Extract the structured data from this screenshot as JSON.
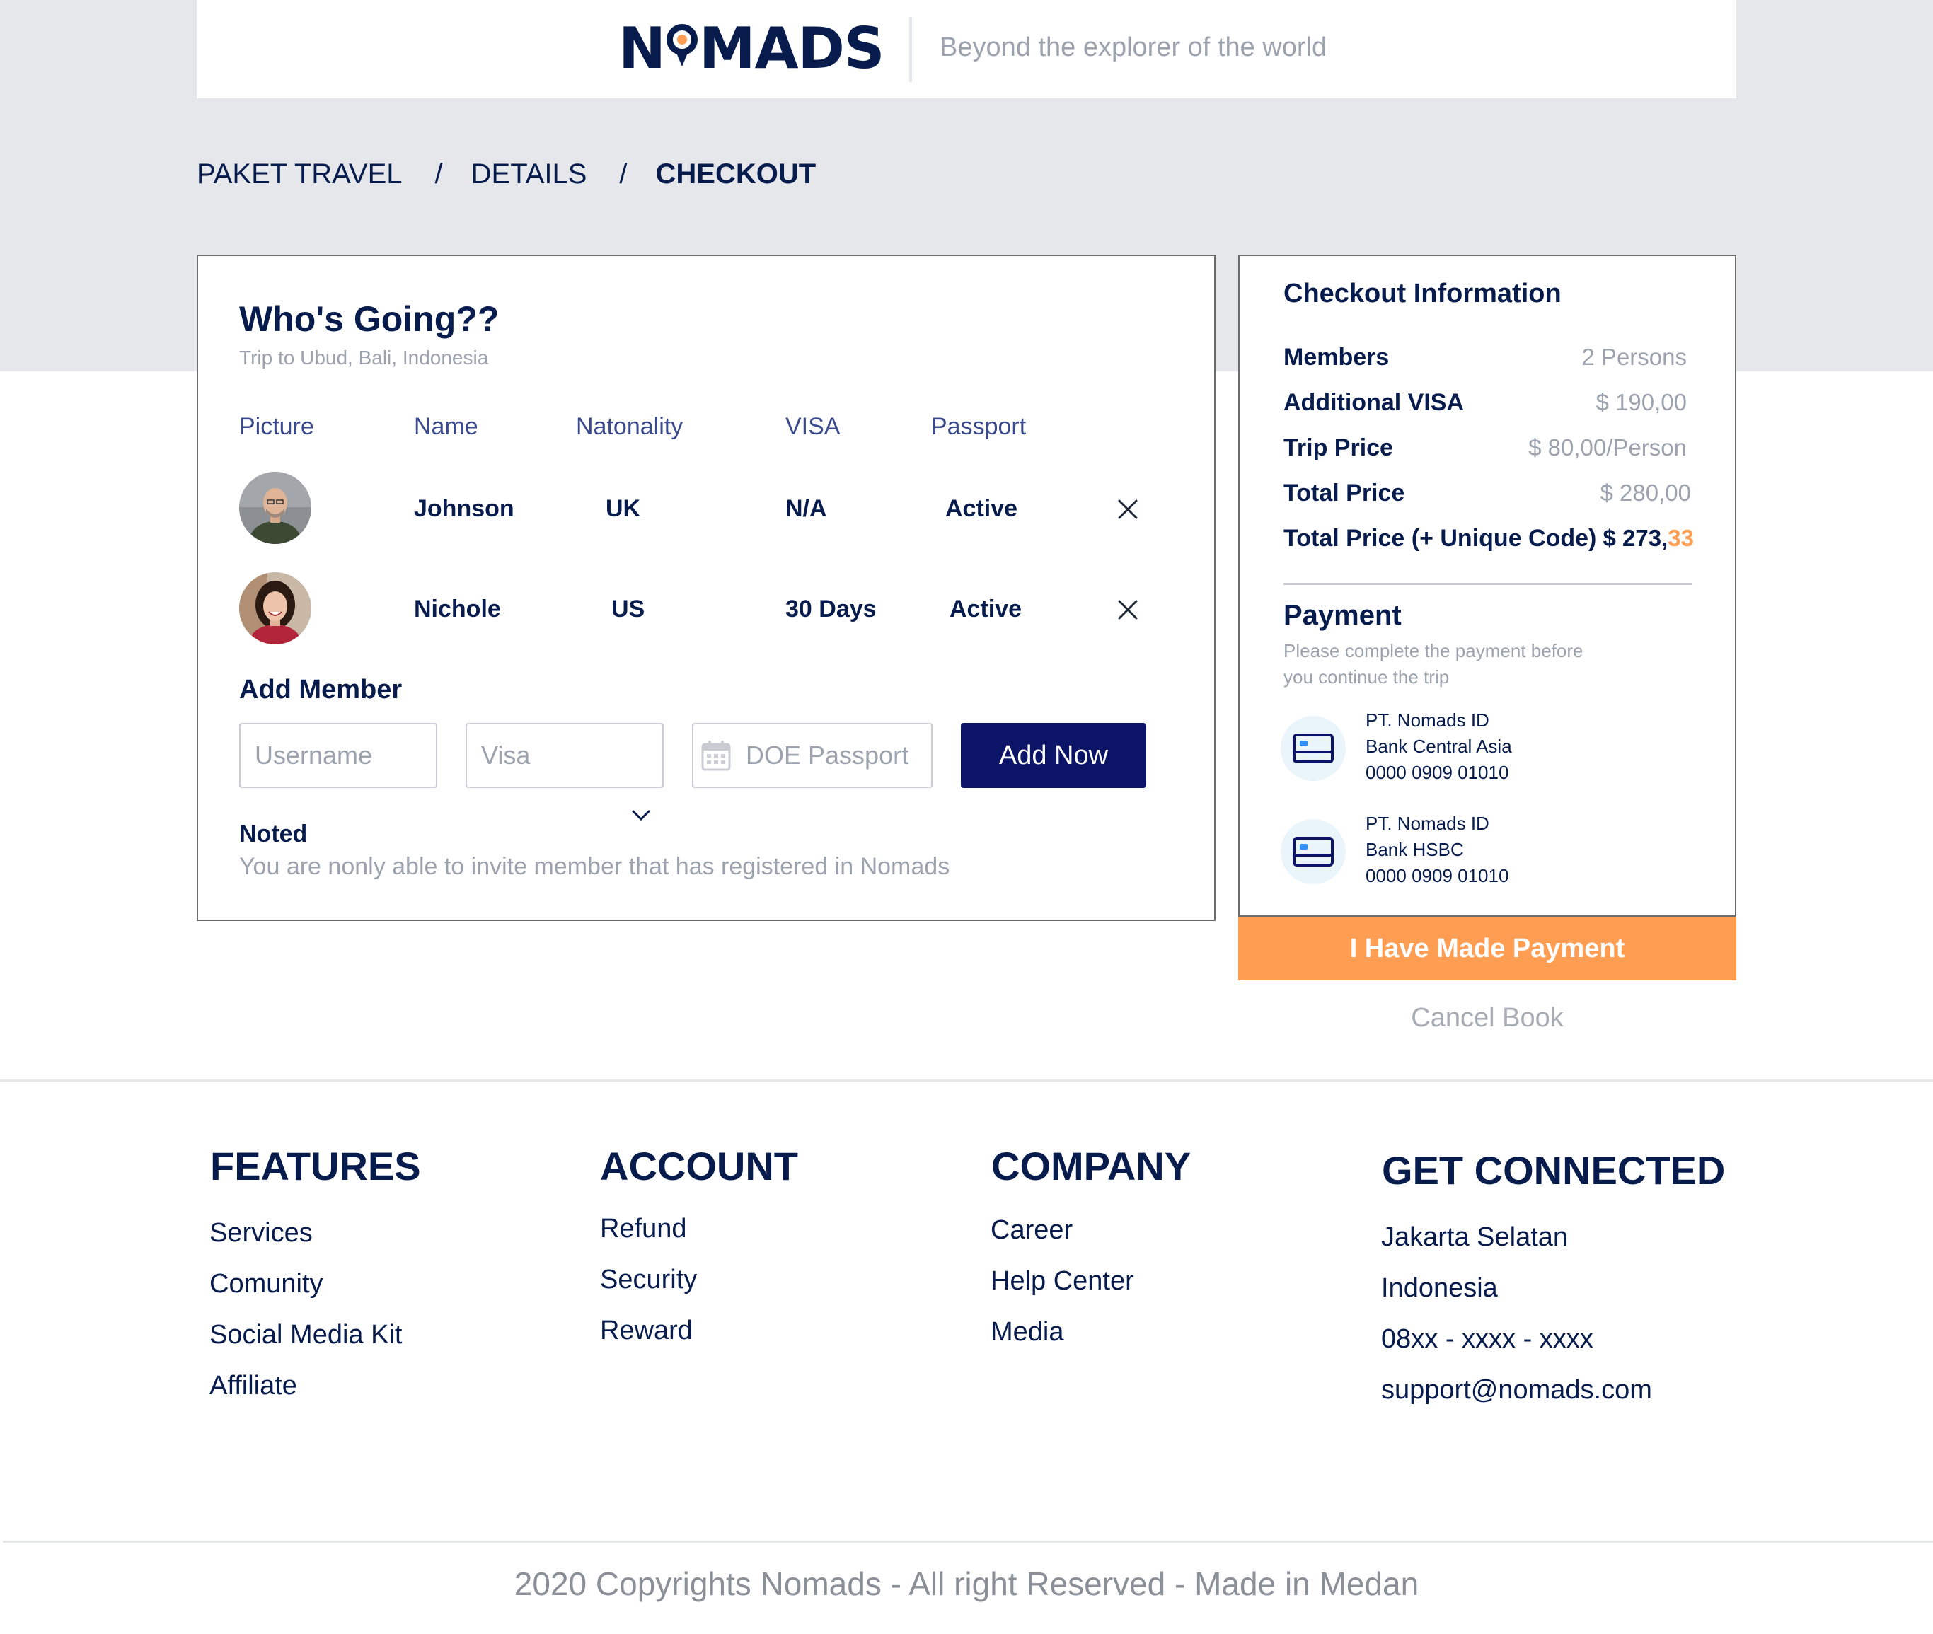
{
  "header": {
    "logo_left": "N",
    "logo_right": "MADS",
    "tagline": "Beyond the explorer of the world"
  },
  "breadcrumb": {
    "items": [
      "PAKET TRAVEL",
      "DETAILS",
      "CHECKOUT"
    ],
    "separator": "/"
  },
  "members": {
    "title": "Who's Going??",
    "subtitle": "Trip to Ubud, Bali, Indonesia",
    "columns": [
      "Picture",
      "Name",
      "Natonality",
      "VISA",
      "Passport"
    ],
    "rows": [
      {
        "name": "Johnson",
        "nationality": "UK",
        "visa": "N/A",
        "passport": "Active"
      },
      {
        "name": "Nichole",
        "nationality": "US",
        "visa": "30 Days",
        "passport": "Active"
      }
    ],
    "add_member_title": "Add Member",
    "username_placeholder": "Username",
    "visa_placeholder": "Visa",
    "passport_placeholder": "DOE Passport",
    "add_button": "Add Now",
    "noted_title": "Noted",
    "noted_text": "You are nonly able to invite member that has registered in Nomads"
  },
  "checkout": {
    "title": "Checkout Information",
    "rows": [
      {
        "label": "Members",
        "value": "2 Persons"
      },
      {
        "label": "Additional VISA",
        "value": "$ 190,00"
      },
      {
        "label": "Trip Price",
        "value": "$ 80,00/Person"
      },
      {
        "label": "Total Price",
        "value": "$ 280,00"
      }
    ],
    "unique_label": "Total Price (+ Unique Code)",
    "unique_value_main": "$ 273,",
    "unique_value_code": "33",
    "payment_title": "Payment",
    "payment_desc": "Please complete the payment before you continue the trip",
    "banks": [
      {
        "company": "PT. Nomads ID",
        "bank": "Bank Central Asia",
        "account": "0000 0909 01010"
      },
      {
        "company": "PT. Nomads ID",
        "bank": "Bank HSBC",
        "account": "0000 0909 01010"
      }
    ],
    "paid_button": "I Have Made Payment",
    "cancel_link": "Cancel Book"
  },
  "footer": {
    "columns": [
      {
        "heading": "FEATURES",
        "items": [
          "Services",
          "Comunity",
          "Social Media Kit",
          "Affiliate"
        ]
      },
      {
        "heading": "ACCOUNT",
        "items": [
          "Refund",
          "Security",
          "Reward"
        ]
      },
      {
        "heading": "COMPANY",
        "items": [
          "Career",
          "Help Center",
          "Media"
        ]
      },
      {
        "heading": "GET CONNECTED",
        "items": [
          "Jakarta Selatan",
          "Indonesia",
          "08xx - xxxx - xxxx",
          "support@nomads.com"
        ]
      }
    ],
    "copyright": "2020 Copyrights Nomads - All right Reserved - Made in Medan"
  },
  "colors": {
    "navy": "#071C4D",
    "button_navy": "#0C1467",
    "accent_orange": "#FF9E53",
    "muted_gray": "#9CA3AF",
    "band_gray": "#E5E7EB"
  }
}
